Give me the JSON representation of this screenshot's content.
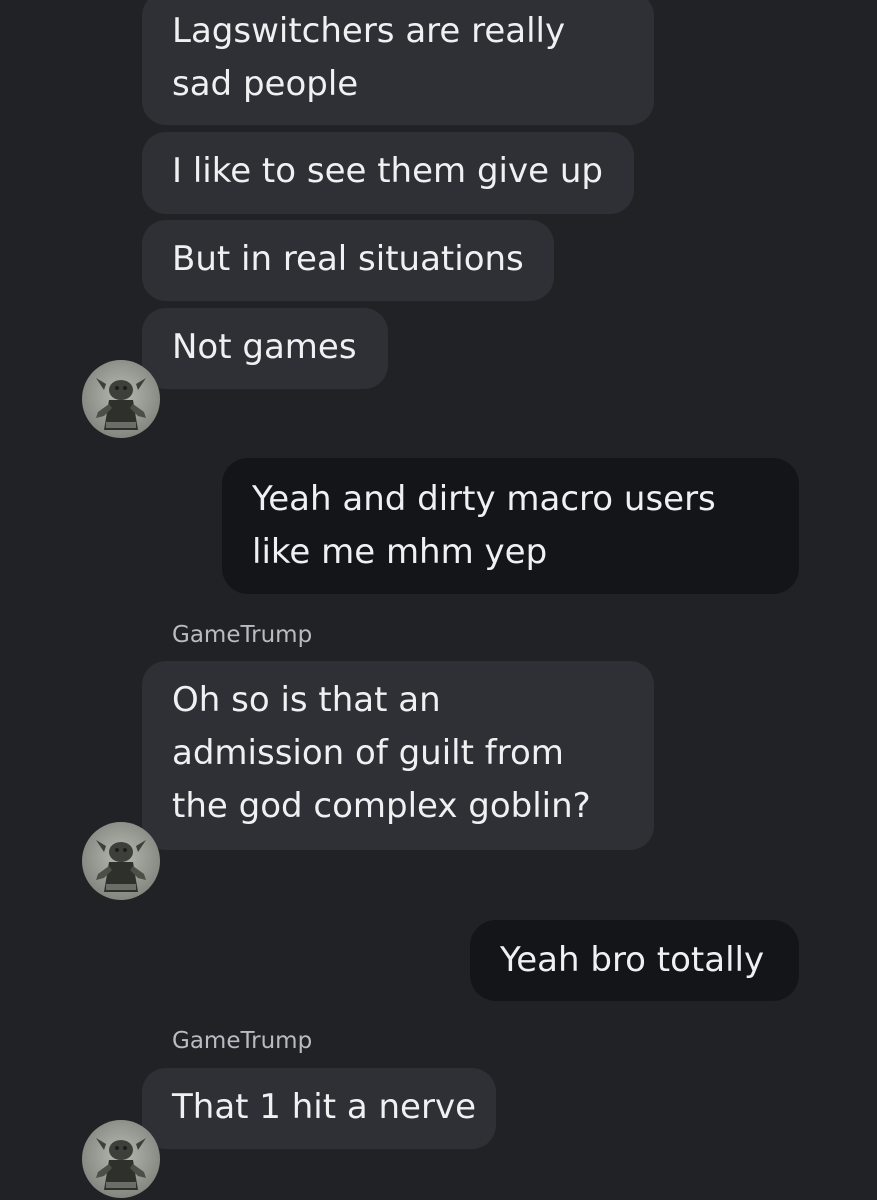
{
  "messages": [
    {
      "from": "other",
      "text_lines": [
        "Lagswitchers are really",
        "sad people"
      ]
    },
    {
      "from": "other",
      "text_lines": [
        "I like to see them give up"
      ]
    },
    {
      "from": "other",
      "text_lines": [
        "But in real situations"
      ]
    },
    {
      "from": "other",
      "text_lines": [
        "Not games"
      ]
    },
    {
      "from": "me",
      "text_lines": [
        "Yeah and dirty macro users",
        "like me mhm yep"
      ]
    },
    {
      "from": "other",
      "sender": "GameTrump",
      "text_lines": [
        "Oh so is that an",
        "admission of guilt from",
        "the god complex goblin?"
      ]
    },
    {
      "from": "me",
      "text_lines": [
        "Yeah bro totally"
      ]
    },
    {
      "from": "other",
      "sender": "GameTrump",
      "text_lines": [
        "That 1 hit a nerve"
      ]
    }
  ],
  "avatar": {
    "icon": "goblin-statue-avatar-icon"
  },
  "colors": {
    "background": "#202226",
    "incoming_bubble": "#2e3035",
    "outgoing_bubble": "#141518",
    "text": "#eff0f2",
    "sender_name": "#b8bbc1"
  }
}
